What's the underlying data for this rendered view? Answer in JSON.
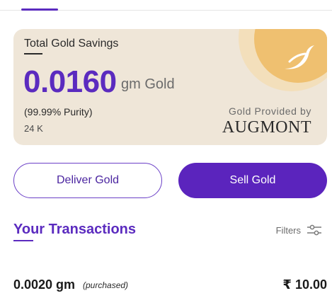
{
  "gold_card": {
    "title": "Total Gold Savings",
    "amount": "0.0160",
    "unit": "gm Gold",
    "purity": "(99.99% Purity)",
    "karat": "24 K",
    "provider_label": "Gold Provided by",
    "provider_name": "AUGMONT",
    "colors": {
      "background": "#efe6d8",
      "brand_gold": "#efc070",
      "amount": "#5b2bbf"
    }
  },
  "actions": {
    "deliver_label": "Deliver Gold",
    "sell_label": "Sell Gold",
    "colors": {
      "primary": "#5b24bd"
    }
  },
  "transactions": {
    "title": "Your Transactions",
    "filters_label": "Filters",
    "filters_icon": "sliders-icon",
    "items": [
      {
        "amount": "0.0020 gm",
        "type": "(purchased)",
        "price": "₹ 10.00"
      }
    ]
  }
}
